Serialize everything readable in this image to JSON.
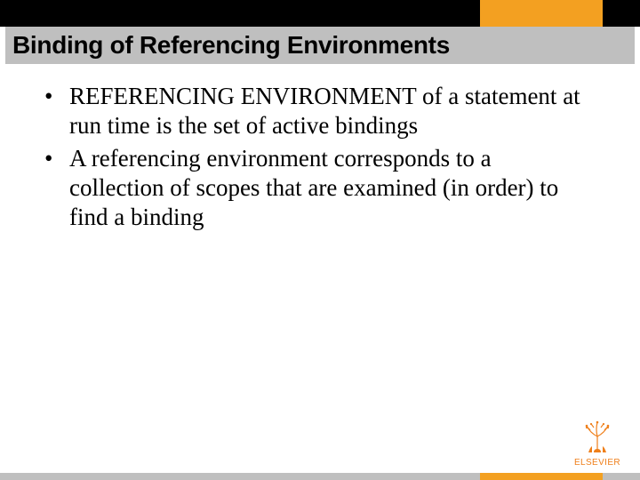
{
  "title": "Binding of Referencing Environments",
  "bullets": [
    "REFERENCING ENVIRONMENT of a statement at run time is the set of active bindings",
    "A referencing environment corresponds to a collection of scopes that are examined (in order) to find a binding"
  ],
  "publisher": "ELSEVIER"
}
